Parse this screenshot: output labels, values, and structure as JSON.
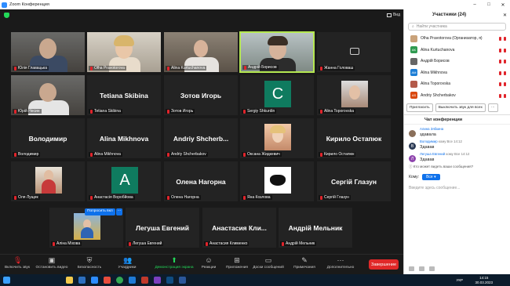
{
  "window": {
    "title": "Zoom Конференция"
  },
  "view_label": "Вид",
  "tiles": [
    {
      "id": "t1",
      "name": "Юлія Главацька",
      "big": ""
    },
    {
      "id": "t2",
      "name": "Olha Pravotorova",
      "big": ""
    },
    {
      "id": "t3",
      "name": "Alina Kurtuchanova",
      "big": ""
    },
    {
      "id": "t4",
      "name": "Андрій Борисов",
      "big": ""
    },
    {
      "id": "t5",
      "name": "Жанна Головаш",
      "big": ""
    },
    {
      "id": "t6",
      "name": "Юрій Несин",
      "big": ""
    },
    {
      "id": "t7",
      "name": "Tetiana Skibina",
      "big": "Tetiana Skibina"
    },
    {
      "id": "t8",
      "name": "Зотов Игорь",
      "big": "Зотов Игорь"
    },
    {
      "id": "t9",
      "name": "Sergiy Shkurdin",
      "big": "C"
    },
    {
      "id": "t10",
      "name": "Alina Toporovska",
      "big": ""
    },
    {
      "id": "t11",
      "name": "Володимир",
      "big": "Володимир"
    },
    {
      "id": "t12",
      "name": "Alina Mikhnova",
      "big": "Alina Mikhnova"
    },
    {
      "id": "t13",
      "name": "Andriy Shcherbakov",
      "big": "Andriy  Shcherb..."
    },
    {
      "id": "t14",
      "name": "Оксана Жидкевич",
      "big": ""
    },
    {
      "id": "t15",
      "name": "Кирило Остапюк",
      "big": "Кирило Остапюк"
    },
    {
      "id": "t16",
      "name": "Оля Лущек",
      "big": ""
    },
    {
      "id": "t17",
      "name": "Анастасія Воробйова",
      "big": "A"
    },
    {
      "id": "t18",
      "name": "Олена Нагорна",
      "big": "Олена Нагорна"
    },
    {
      "id": "t19",
      "name": "Яна Козлова",
      "big": ""
    },
    {
      "id": "t20",
      "name": "Сергій Глазун",
      "big": "Сергій Глазун"
    },
    {
      "id": "t21",
      "name": "Аліна Міхова",
      "big": ""
    },
    {
      "id": "t22",
      "name": "Легуша Евгений",
      "big": "Легуша Евгений"
    },
    {
      "id": "t23",
      "name": "Анастасия Клименко",
      "big": "Анастасия  Кли..."
    },
    {
      "id": "t24",
      "name": "Андрій Мельник",
      "big": "Андрій Мельник"
    }
  ],
  "hover_tooltip": "Попросить вкл",
  "toolbar": {
    "mute": "Включить звук",
    "video": "Остановить видео",
    "security": "Безопасность",
    "participants": "Участники",
    "participants_count": "24",
    "share": "Демонстрация экрана",
    "reactions": "Реакции",
    "apps": "Приложения",
    "whiteboards": "Доски сообщений",
    "notes": "Примечания",
    "more": "Дополнительно",
    "end": "Завершение"
  },
  "participants_panel": {
    "title": "Участники (24)",
    "search_placeholder": "Найти участника",
    "rows": [
      {
        "initials": "",
        "name": "Olha Pravotorova (Организатор, я)",
        "color": "#c9a27a"
      },
      {
        "initials": "AK",
        "name": "Alina Kurtuchanova",
        "color": "#2f9a50"
      },
      {
        "initials": "",
        "name": "Андрій Борисов",
        "color": "#666666"
      },
      {
        "initials": "AM",
        "name": "Alina Mikhnova",
        "color": "#1c7ed6"
      },
      {
        "initials": "",
        "name": "Alina Toporovska",
        "color": "#b35a4a"
      },
      {
        "initials": "AS",
        "name": "Andriy Shcherbakov",
        "color": "#d9480f"
      }
    ],
    "invite": "Пригласить",
    "mute_all": "Выключить звук для всех"
  },
  "chat": {
    "title": "Чат конференции",
    "messages": [
      {
        "avatar": "",
        "avatar_color": "#8a6f5a",
        "sender": "Алина Зябкина",
        "meta": "",
        "text": "здавала"
      },
      {
        "avatar": "B",
        "avatar_color": "#2b3a55",
        "sender": "Володимир",
        "meta": "кому Все 14:12",
        "text": "Здавав"
      },
      {
        "avatar": "Л",
        "avatar_color": "#8e44ad",
        "sender": "Легуша Евгений",
        "meta": "кому Все 14:12",
        "text": "Здавав"
      }
    ],
    "pinned": "Кто может видеть ваши сообщения?",
    "to_label": "Кому:",
    "to_value": "Все",
    "input_placeholder": "Введите здесь сообщение..."
  },
  "taskbar": {
    "lang": "УКР",
    "time": "14:15",
    "date": "30.03.2023"
  }
}
